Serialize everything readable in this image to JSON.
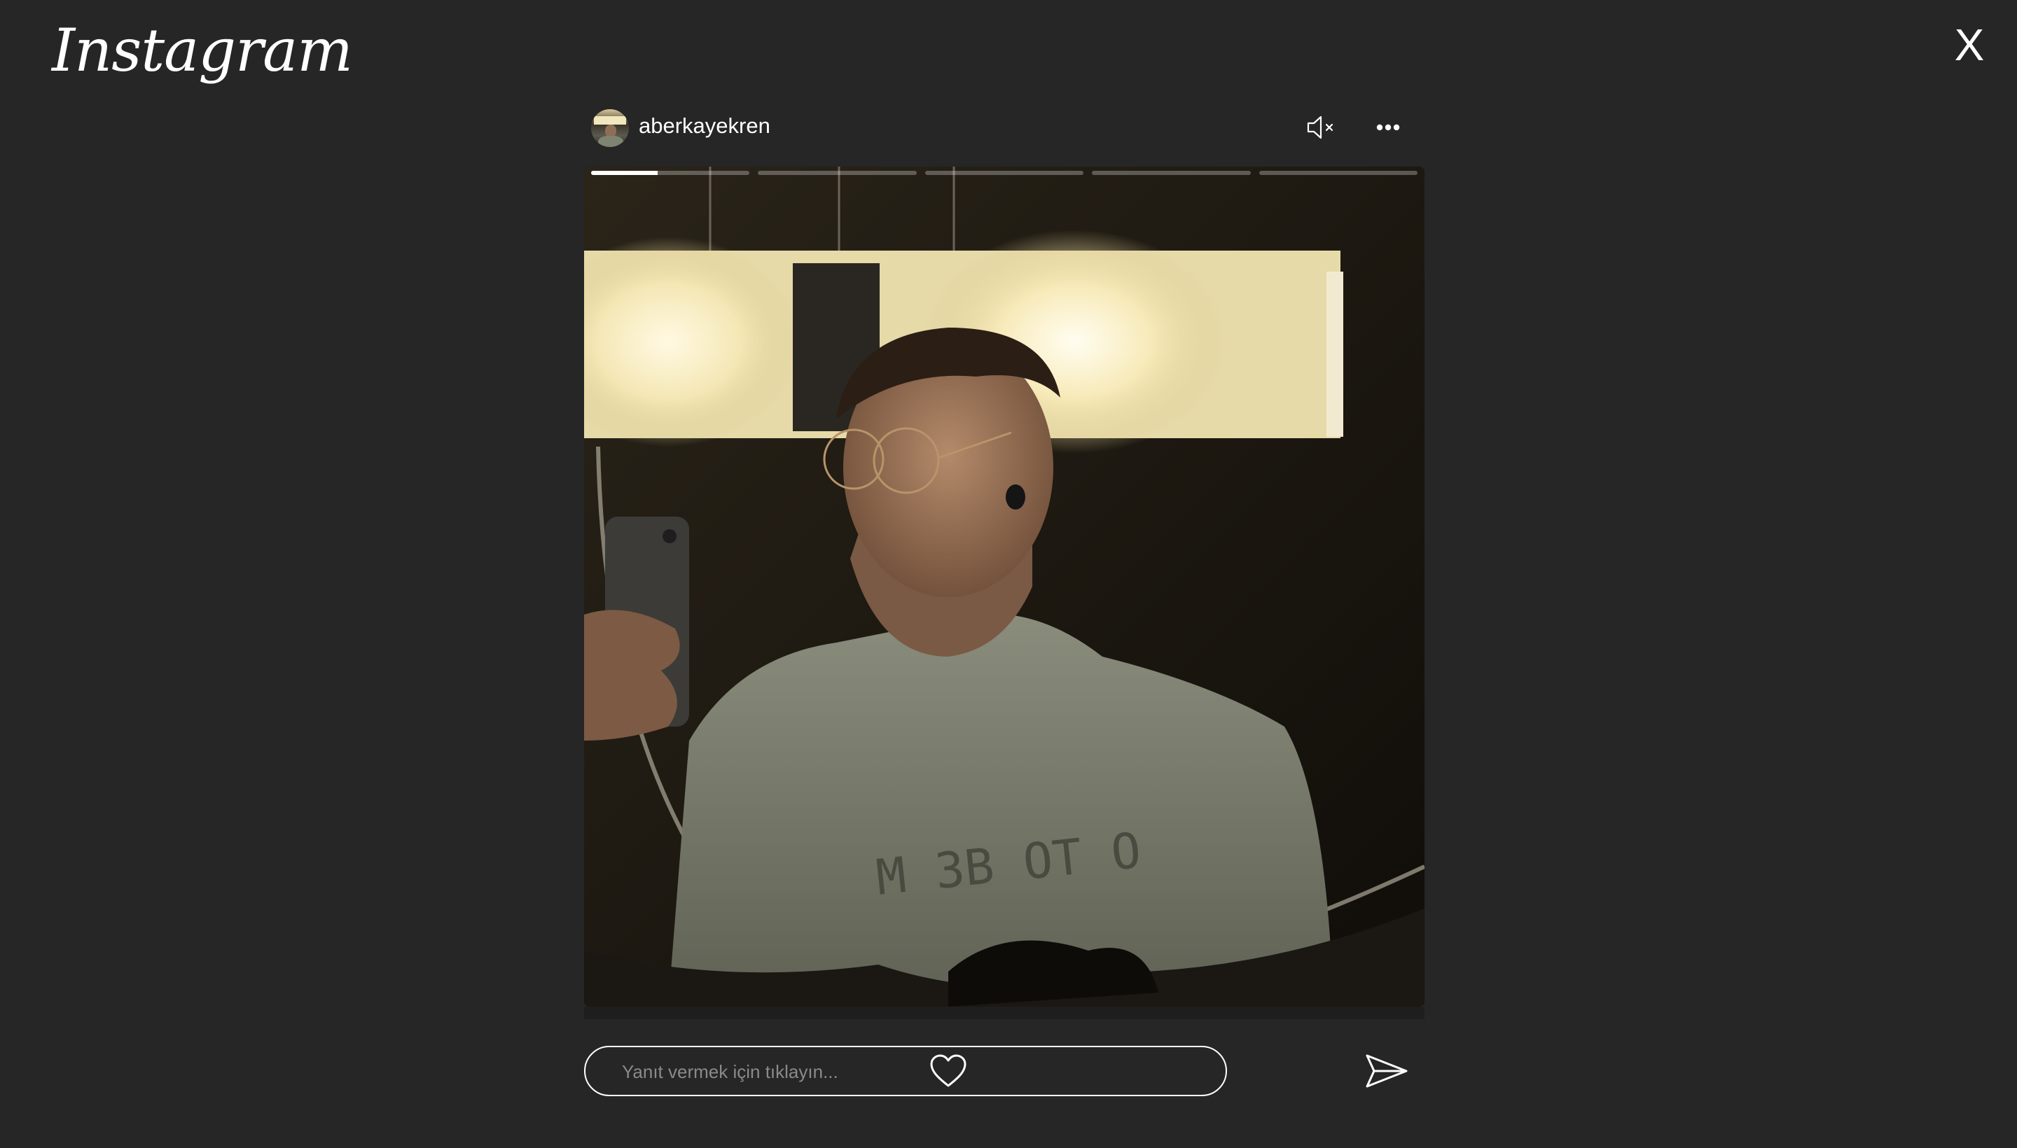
{
  "app": {
    "logo_text": "Instagram",
    "close_label": "X"
  },
  "story": {
    "username": "aberkayekren",
    "progress_segments": [
      0.42,
      0,
      0,
      0,
      0
    ],
    "mute_icon": "speaker-muted-icon",
    "more_icon": "more-horizontal-icon"
  },
  "reply": {
    "placeholder": "Yanıt vermek için tıklayın...",
    "value": "",
    "like_icon": "heart-icon",
    "send_icon": "send-icon"
  },
  "colors": {
    "background": "#262626",
    "text": "#ffffff",
    "placeholder": "#8a8a8a"
  }
}
